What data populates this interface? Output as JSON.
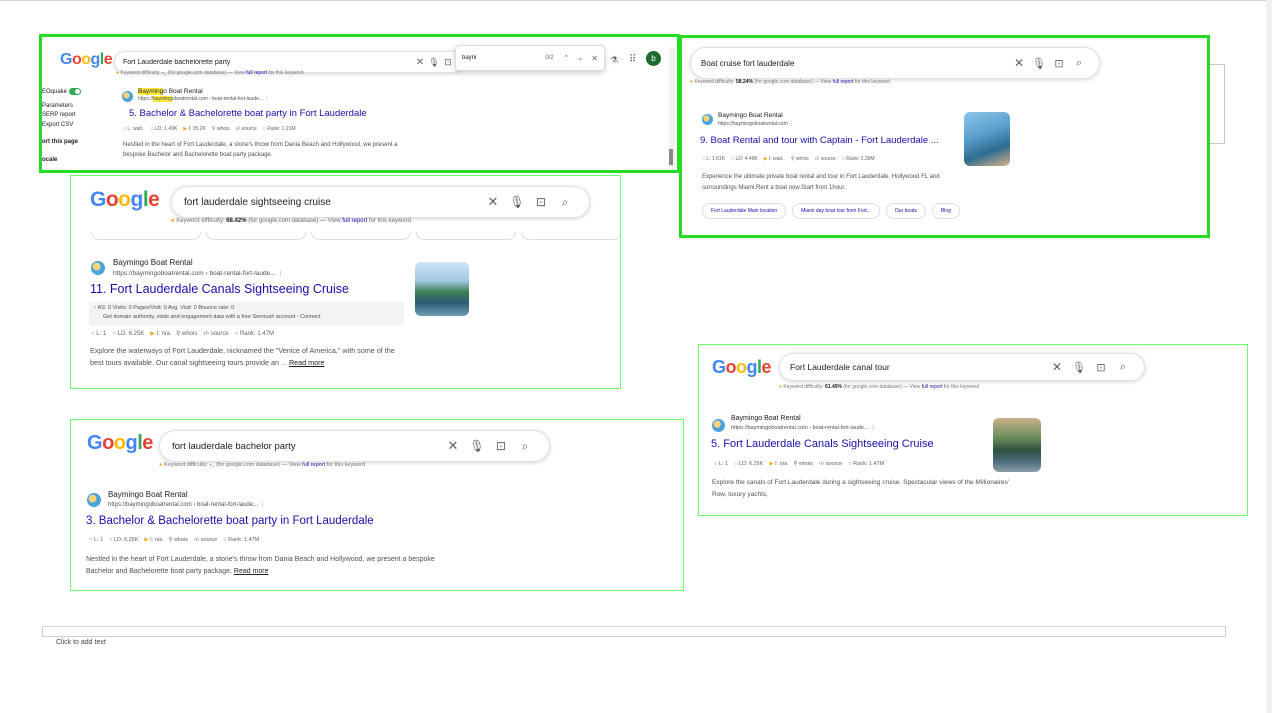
{
  "colors": {
    "highlight_border": "#22dd22",
    "link": "#1a0dab",
    "metric_orange": "#e8562a"
  },
  "panel1": {
    "query": "Fort Lauderdale bachelorette party",
    "kd": {
      "label": "Keyword difficulty:",
      "value": "-_",
      "db": "(for google.com database) —",
      "view": "View",
      "report": "full report",
      "tail": "for this keyword"
    },
    "find": {
      "text": "bayni",
      "count": "0/2"
    },
    "avatar": "b",
    "sidebar": [
      "EOquake",
      "Parameters",
      "SERP report",
      "Export CSV",
      "ort this page",
      "ocale"
    ],
    "site_name_hl": "Bayming",
    "site_name_rest": "o Boat Rental",
    "url_pre": "https://",
    "url_hl": "bayming",
    "url_rest": "oboatrental.com › boat-rental-fort-laude...",
    "title": "5. Bachelor & Bachelorette boat party in Fort Lauderdale",
    "metrics": {
      "l": "L: wait..",
      "ld": "LD: 1.49K",
      "i": "I: 35.2K",
      "whois": "whois",
      "source": "source",
      "rank": "Rank: 1.21M"
    },
    "snippet": "Nestled in the heart of Fort Lauderdale, a stone's throw from Dania Beach and Hollywood, we present a bespoke Bachelor and Bachelorette boat party package."
  },
  "panel2": {
    "query": "Boat cruise fort lauderdale",
    "kd": {
      "label": "Keyword difficulty:",
      "value": "58.24%",
      "db": "(for google.com database) —",
      "view": "View",
      "report": "full report",
      "tail": "for this keyword"
    },
    "site_name": "Baymingo Boat Rental",
    "url": "https://baymingoboatrental.com",
    "title": "9. Boat Rental and tour with Captain - Fort Lauderdale ...",
    "metrics": {
      "l": "L: 1.61K",
      "ld": "LD: 4.49K",
      "i": "I: wait..",
      "whois": "whois",
      "source": "source",
      "rank": "Rank: 1.39M"
    },
    "snippet": "Experience the ultimate private boat rental and tour in Fort Lauderdale, Hollywood FL and surroundings Miami.Rent a boat now.Start from 1hour.",
    "sitelinks": [
      "Fort Lauderdale Main location",
      "Miami day boat tour from Fort...",
      "Our boats",
      "Blog"
    ]
  },
  "panel3": {
    "query": "fort lauderdale sightseeing cruise",
    "kd": {
      "label": "Keyword difficulty:",
      "value": "68.42%",
      "db": "(for google.com database) —",
      "view": "View",
      "report": "full report",
      "tail": "for this keyword"
    },
    "site_name": "Baymingo Boat Rental",
    "url": "https://baymingoboatrental.com › boat-rental-fort-laude...",
    "title": "11. Fort Lauderdale Canals Sightseeing Cruise",
    "semrush1": "AS: 0          Visits: 0    Pages/Visit: 0    Avg. Visit: 0    Bounce rate: 0",
    "semrush2": "Get domain authority, visits and engagement data with a free Semrush account - Connect",
    "metrics": {
      "l": "L: 1",
      "ld": "LD: 6.25K",
      "i": "I: n/a",
      "whois": "whois",
      "source": "source",
      "rank": "Rank: 1.47M"
    },
    "snippet": "Explore the waterways of Fort Lauderdale, nicknamed the \"Venice of America,\" with some of the best tours available. Our canal sightseeing tours provide an ...",
    "read_more": "Read more"
  },
  "panel4": {
    "query": "fort lauderdale bachelor party",
    "kd": {
      "label": "Keyword difficulty:",
      "value": "-_",
      "db": "(for google.com database) —",
      "view": "View",
      "report": "full report",
      "tail": "for this keyword"
    },
    "site_name": "Baymingo Boat Rental",
    "url": "https://baymingoboatrental.com › boat-rental-fort-laude...",
    "title": "3. Bachelor & Bachelorette boat party in Fort Lauderdale",
    "metrics": {
      "l": "L: 1",
      "ld": "LD: 6.25K",
      "i": "I: n/a",
      "whois": "whois",
      "source": "source",
      "rank": "Rank: 1.47M"
    },
    "snippet": "Nestled in the heart of Fort Lauderdale, a stone's throw from Dania Beach and Hollywood, we present a bespoke Bachelor and Bachelorette boat party package.",
    "read_more": "Read more"
  },
  "panel5": {
    "query": "Fort Lauderdale canal tour",
    "kd": {
      "label": "Keyword difficulty:",
      "value": "61.49%",
      "db": "(for google.com database) —",
      "view": "View",
      "report": "full report",
      "tail": "for this keyword"
    },
    "site_name": "Baymingo Boat Rental",
    "url": "https://baymingoboatrental.com › boat-rental-fort-laude...",
    "title": "5. Fort Lauderdale Canals Sightseeing Cruise",
    "metrics": {
      "l": "L: 1",
      "ld": "LD: 6.25K",
      "i": "I: n/a",
      "whois": "whois",
      "source": "source",
      "rank": "Rank: 1.47M"
    },
    "snippet": "Explore the canals of Fort Lauderdale during a sightseeing cruise. Spectacular views of the Millionaires' Row, luxury yachts,"
  },
  "logo": [
    "G",
    "o",
    "o",
    "g",
    "l",
    "e"
  ],
  "footer": {
    "placeholder": "Click to add text"
  }
}
